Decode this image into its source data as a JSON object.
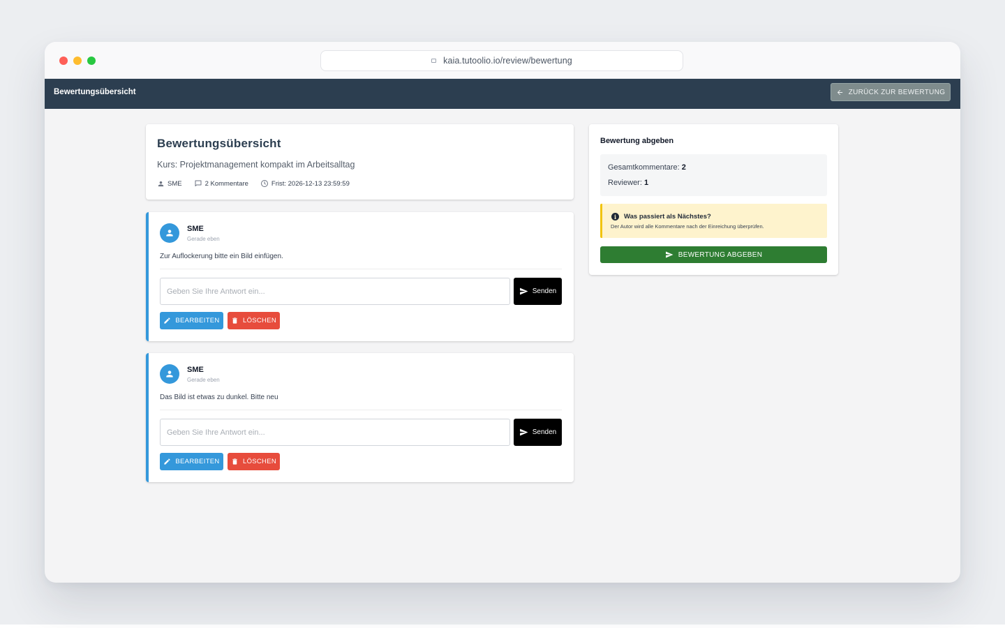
{
  "browser": {
    "url": "kaia.tutoolio.io/review/bewertung"
  },
  "appbar": {
    "title": "Bewertungsübersicht",
    "back_label": "ZURÜCK ZUR BEWERTUNG"
  },
  "overview": {
    "title": "Bewertungsübersicht",
    "course": "Kurs: Projektmanagement kompakt im Arbeitsalltag",
    "meta": {
      "user": "SME",
      "comments": "2 Kommentare",
      "deadline": "Frist: 2026-12-13 23:59:59"
    }
  },
  "comments": [
    {
      "author": "SME",
      "time": "Gerade eben",
      "text": "Zur Auflockerung bitte ein Bild einfügen.",
      "reply_placeholder": "Geben Sie Ihre Antwort ein...",
      "send_label": "Senden",
      "edit_label": "BEARBEITEN",
      "delete_label": "LÖSCHEN"
    },
    {
      "author": "SME",
      "time": "Gerade eben",
      "text": "Das Bild ist etwas zu dunkel. Bitte neu",
      "reply_placeholder": "Geben Sie Ihre Antwort ein...",
      "send_label": "Senden",
      "edit_label": "BEARBEITEN",
      "delete_label": "LÖSCHEN"
    }
  ],
  "sidebar": {
    "title": "Bewertung abgeben",
    "stats": {
      "total_label": "Gesamtkommentare:",
      "total_value": "2",
      "reviewer_label": "Reviewer:",
      "reviewer_value": "1"
    },
    "info": {
      "title": "Was passiert als Nächstes?",
      "text": "Der Autor wird alle Kommentare nach der Einreichung überprüfen."
    },
    "submit_label": "BEWERTUNG ABGEBEN"
  },
  "colors": {
    "appbar": "#2c3e50",
    "accent_blue": "#3498db",
    "danger": "#e74c3c",
    "success": "#2e7d32",
    "warning_bg": "#fef3cd",
    "warning_border": "#f1c40f"
  },
  "icons": {
    "back": "arrow-left-icon",
    "user": "person-icon",
    "comments": "chat-bubble-icon",
    "deadline": "clock-icon",
    "avatar": "person-icon",
    "send": "send-icon",
    "edit": "pencil-icon",
    "delete": "trash-icon",
    "info": "info-icon"
  }
}
